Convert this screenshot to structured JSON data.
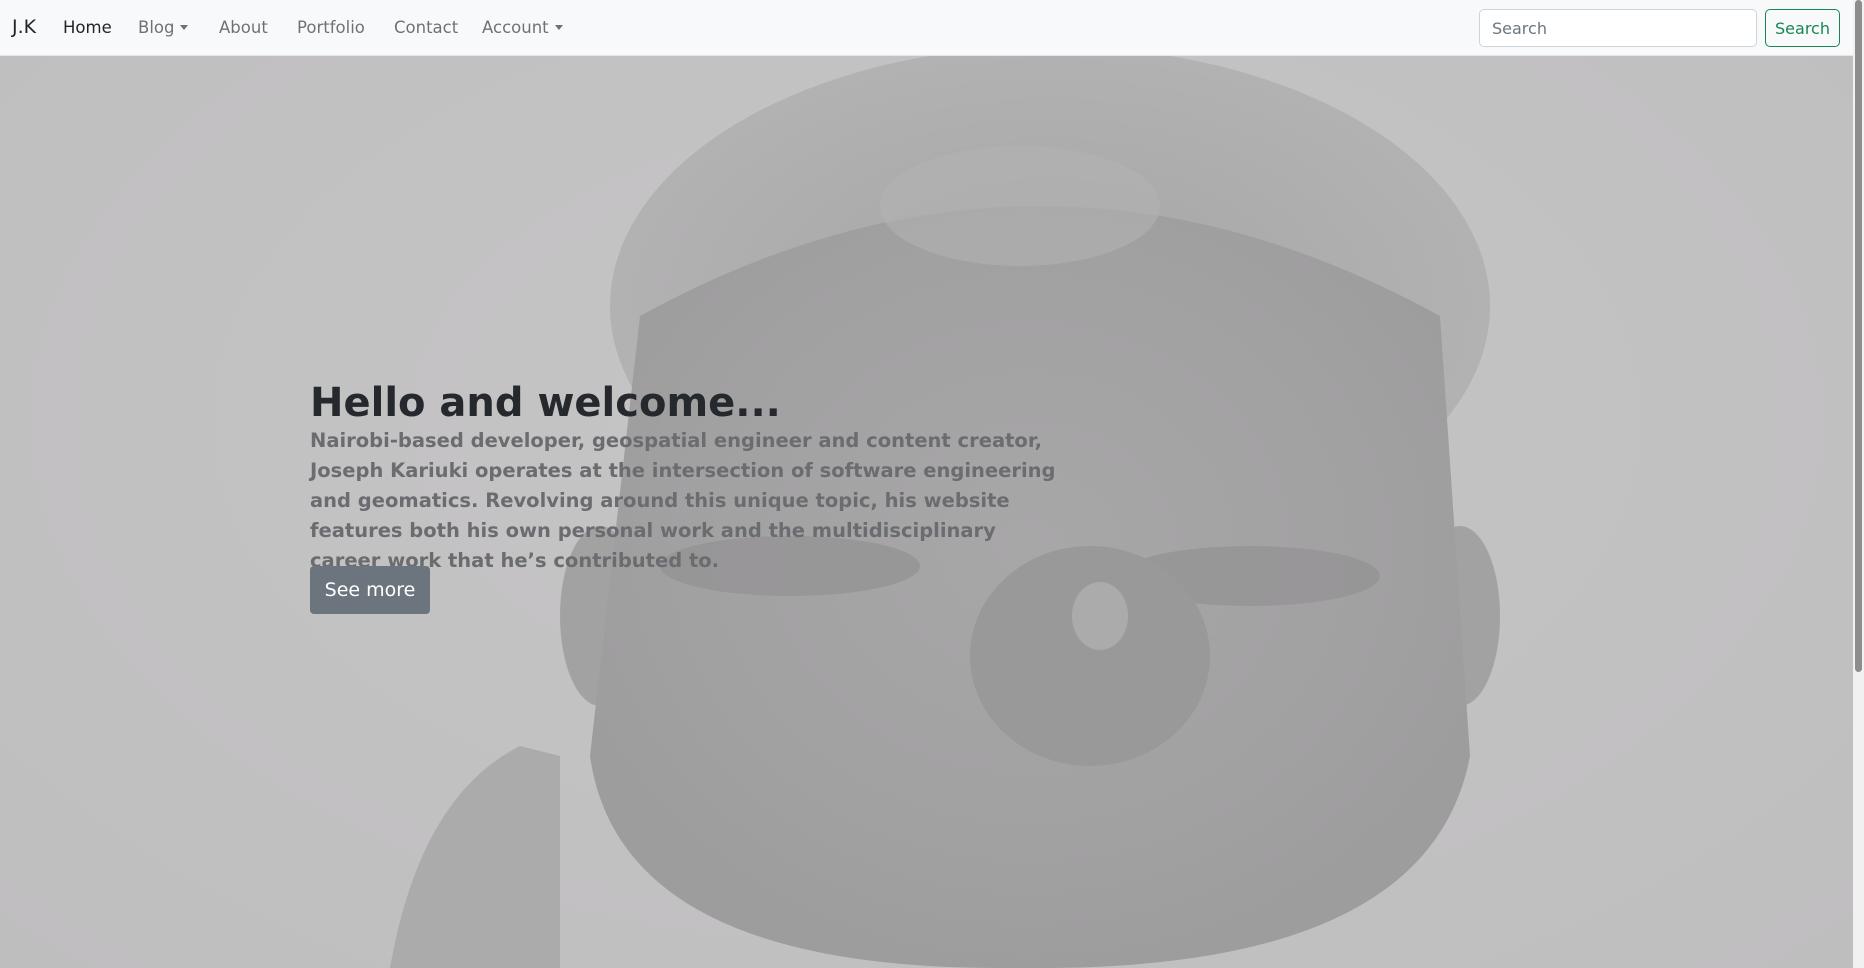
{
  "navbar": {
    "brand": "J.K",
    "items": [
      {
        "label": "Home",
        "active": true,
        "dropdown": false
      },
      {
        "label": "Blog",
        "active": false,
        "dropdown": true
      },
      {
        "label": "About",
        "active": false,
        "dropdown": false
      },
      {
        "label": "Portfolio",
        "active": false,
        "dropdown": false
      },
      {
        "label": "Contact",
        "active": false,
        "dropdown": false
      },
      {
        "label": "Account",
        "active": false,
        "dropdown": true
      }
    ],
    "search": {
      "placeholder": "Search",
      "value": "",
      "button_label": "Search"
    }
  },
  "hero": {
    "title": "Hello and welcome...",
    "text": "Nairobi-based developer, geospatial engineer and content creator, Joseph Kariuki operates at the intersection of software engineering and geomatics. Revolving around this unique topic, his website features both his own personal work and the multidisciplinary career work that he’s contributed to.",
    "button_label": "See more",
    "background_image": "portrait-photo"
  },
  "colors": {
    "navbar_bg": "#f8f9fa",
    "accent_success": "#198754",
    "button_secondary": "#6c757d",
    "hero_overlay": "#c6c5c6"
  }
}
